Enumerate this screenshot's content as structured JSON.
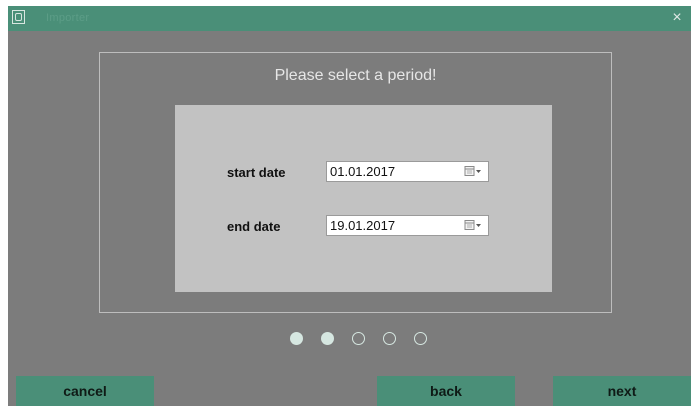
{
  "window": {
    "title": "Importer",
    "close_glyph": "×",
    "icons": [
      "app-icon",
      "close-icon",
      "calendar-icon",
      "chevron-down-icon"
    ]
  },
  "wizard": {
    "heading": "Please select a period!",
    "start": {
      "label": "start date",
      "value": "01.01.2017"
    },
    "end": {
      "label": "end date",
      "value": "19.01.2017"
    },
    "steps": {
      "total": 5,
      "current": 2
    }
  },
  "buttons": {
    "cancel": "cancel",
    "back": "back",
    "next": "next"
  },
  "colors": {
    "accent": "#4a8f78",
    "background": "#7c7c7c",
    "panel": "#c2c2c2",
    "heading_text": "#e6e6e6"
  }
}
